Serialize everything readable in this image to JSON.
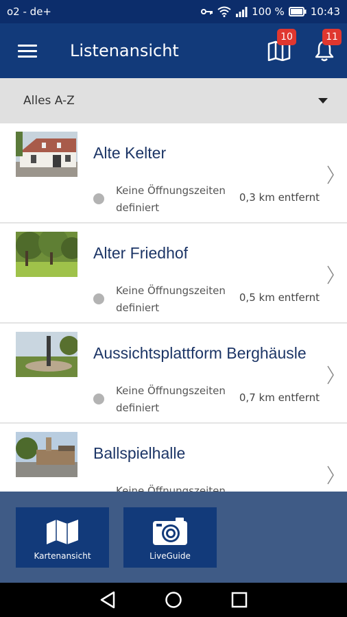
{
  "status_bar": {
    "carrier": "o2 - de+",
    "battery": "100 %",
    "time": "10:43"
  },
  "app_bar": {
    "title": "Listenansicht",
    "map_badge": "10",
    "bell_badge": "11"
  },
  "filter": {
    "label": "Alles A-Z"
  },
  "items": [
    {
      "name": "Alte Kelter",
      "hours": "Keine Öffnungszeiten definiert",
      "distance": "0,3 km entfernt"
    },
    {
      "name": "Alter Friedhof",
      "hours": "Keine Öffnungszeiten definiert",
      "distance": "0,5 km entfernt"
    },
    {
      "name": "Aussichtsplattform Berghäusle",
      "hours": "Keine Öffnungszeiten definiert",
      "distance": "0,7 km entfernt"
    },
    {
      "name": "Ballspielhalle",
      "hours": "Keine Öffnungszeiten definiert",
      "distance": ""
    }
  ],
  "bottom_buttons": {
    "map_label": "Kartenansicht",
    "liveguide_label": "LiveGuide"
  },
  "colors": {
    "primary": "#123a7a",
    "status": "#0c2d6b",
    "badge": "#e0372f",
    "panel": "#3f5b86"
  }
}
